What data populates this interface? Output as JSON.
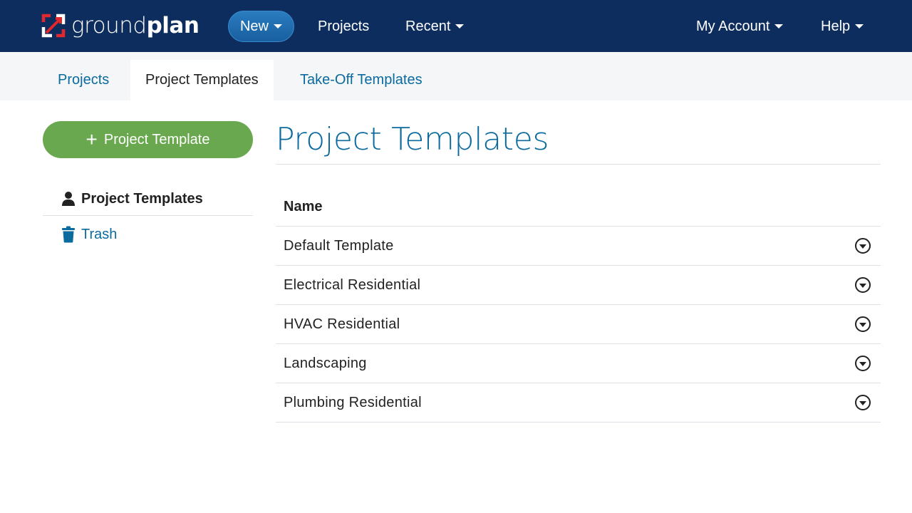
{
  "brand": {
    "name_light": "ground",
    "name_bold": "plan"
  },
  "topnav": {
    "new_label": "New",
    "projects_label": "Projects",
    "recent_label": "Recent",
    "account_label": "My Account",
    "help_label": "Help"
  },
  "tabs": [
    {
      "label": "Projects",
      "active": false
    },
    {
      "label": "Project Templates",
      "active": true
    },
    {
      "label": "Take-Off Templates",
      "active": false
    }
  ],
  "sidebar": {
    "add_button_label": "Project Template",
    "current_label": "Project Templates",
    "trash_label": "Trash"
  },
  "main": {
    "title": "Project Templates",
    "table": {
      "header": "Name",
      "rows": [
        "Default Template",
        "Electrical Residential",
        "HVAC Residential",
        "Landscaping",
        "Plumbing Residential"
      ]
    }
  },
  "icons": {
    "logo": "groundplan-logo-icon",
    "new_caret": "caret-down-icon",
    "current_folder": "user-icon",
    "trash": "trash-icon",
    "row_action": "circle-caret-down-icon"
  },
  "colors": {
    "navbar": "#0d2d5e",
    "accent_blue": "#0b6a9e",
    "add_green": "#6aa84f",
    "logo_red": "#e0282e"
  }
}
